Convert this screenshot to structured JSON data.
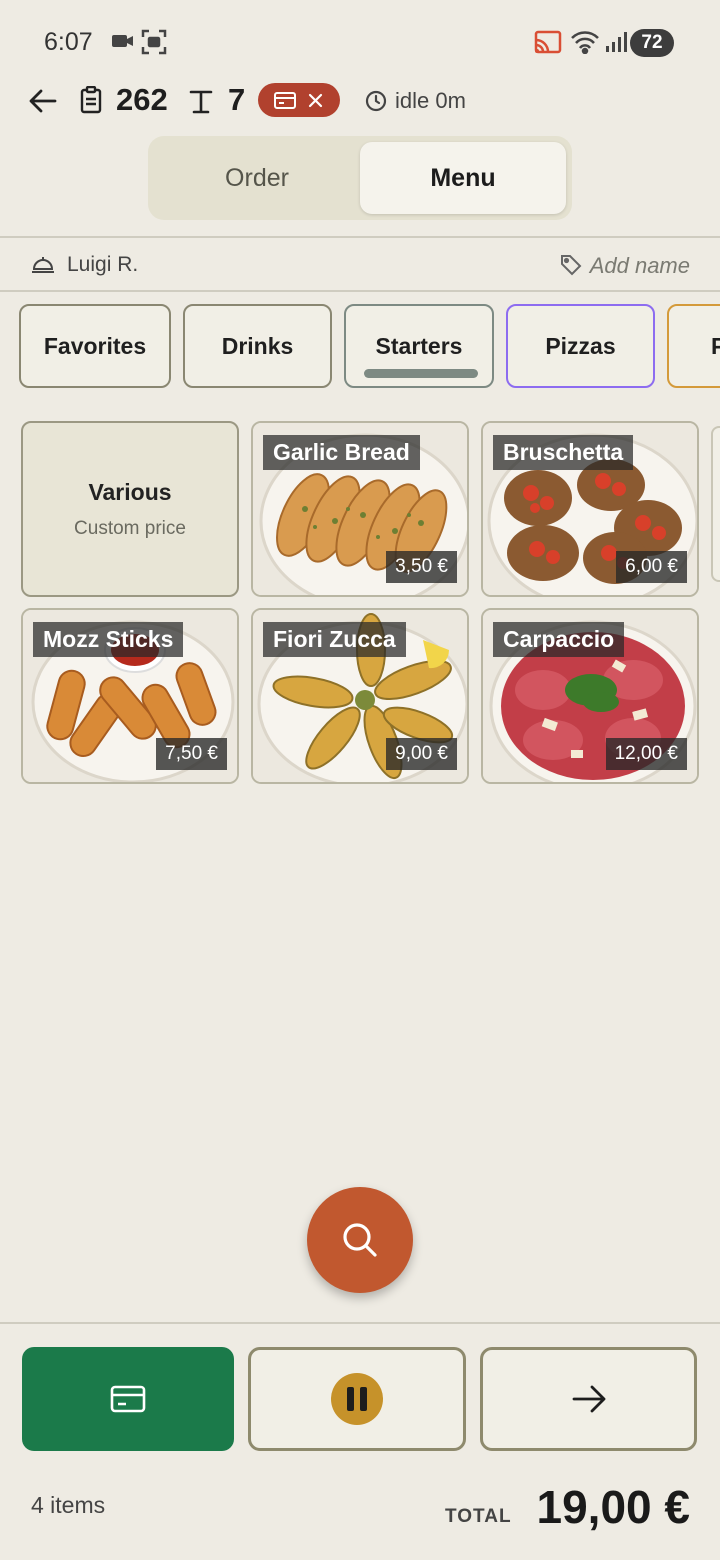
{
  "status_bar": {
    "time": "6:07",
    "battery": "72",
    "icons": [
      "video-camera-icon",
      "screen-capture-icon",
      "cast-icon",
      "wifi-icon",
      "signal-icon"
    ]
  },
  "header": {
    "order_number": "262",
    "table_number": "7",
    "idle_text": "idle 0m",
    "badge_color": "#b1412e"
  },
  "tabs": {
    "order": "Order",
    "menu": "Menu",
    "selected": "Menu"
  },
  "waiter": {
    "name": "Luigi R.",
    "add_name": "Add name"
  },
  "categories": [
    {
      "label": "Favorites"
    },
    {
      "label": "Drinks"
    },
    {
      "label": "Starters",
      "selected": true
    },
    {
      "label": "Pizzas"
    },
    {
      "label": "P"
    }
  ],
  "products": {
    "various": {
      "title": "Various",
      "subtitle": "Custom price"
    },
    "items": [
      {
        "name": "Garlic Bread",
        "price": "3,50 €"
      },
      {
        "name": "Bruschetta",
        "price": "6,00 €"
      },
      {
        "name": "Mozz Sticks",
        "price": "7,50 €"
      },
      {
        "name": "Fiori Zucca",
        "price": "9,00 €"
      },
      {
        "name": "Carpaccio",
        "price": "12,00 €"
      }
    ]
  },
  "footer": {
    "items_count": "4 items",
    "total_label": "TOTAL",
    "total_value": "19,00 €",
    "pay_color": "#1b7a4a",
    "search_color": "#c1582f"
  }
}
